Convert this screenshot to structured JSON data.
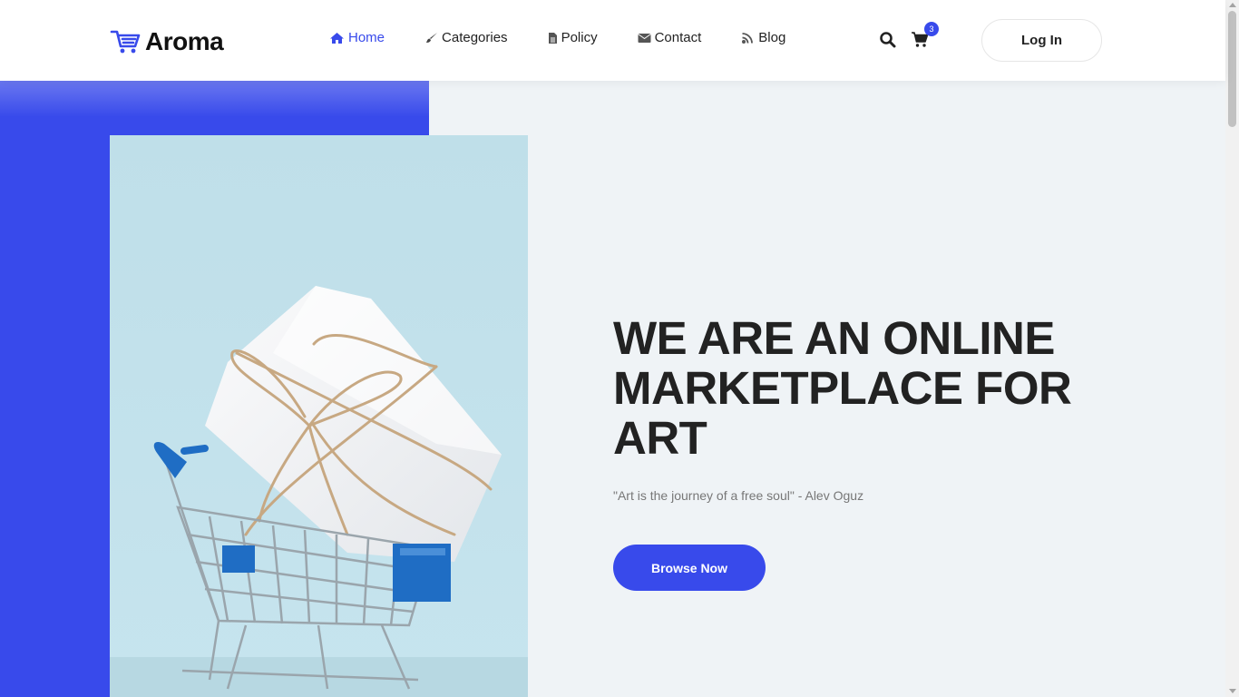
{
  "brand": {
    "name": "Aroma",
    "icon": "cart-logo-icon",
    "accent": "#384aeb"
  },
  "nav": [
    {
      "label": "Home",
      "icon": "home-icon",
      "active": true
    },
    {
      "label": "Categories",
      "icon": "brush-icon",
      "active": false
    },
    {
      "label": "Policy",
      "icon": "document-icon",
      "active": false
    },
    {
      "label": "Contact",
      "icon": "envelope-icon",
      "active": false
    },
    {
      "label": "Blog",
      "icon": "rss-icon",
      "active": false
    }
  ],
  "header": {
    "cart_count": "3",
    "login_label": "Log In"
  },
  "hero": {
    "title": "WE ARE AN ONLINE MARKETPLACE FOR ART",
    "quote": "\"Art is the journey of a free soul\" - Alev Oguz",
    "cta": "Browse Now",
    "image": "shopping-cart-with-gift-box"
  }
}
